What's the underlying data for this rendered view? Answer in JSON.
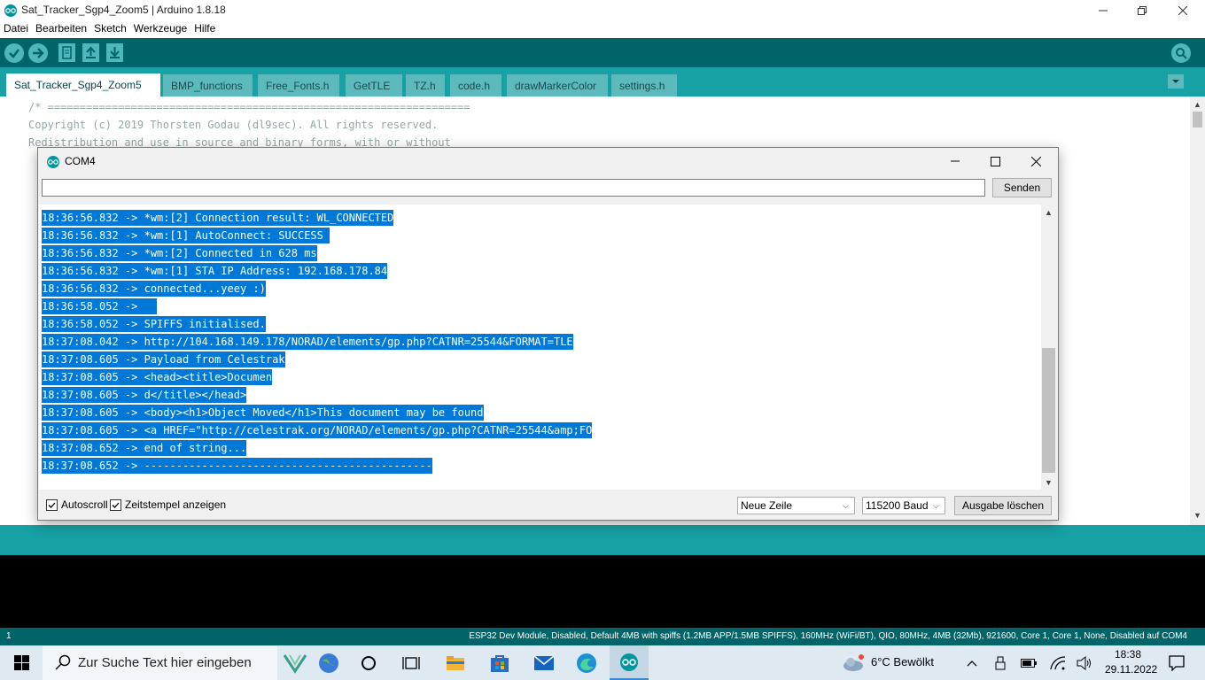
{
  "window": {
    "title": "Sat_Tracker_Sgp4_Zoom5 | Arduino 1.8.18"
  },
  "menu": [
    "Datei",
    "Bearbeiten",
    "Sketch",
    "Werkzeuge",
    "Hilfe"
  ],
  "toolbar": {
    "buttons": [
      "verify-icon",
      "upload-icon",
      "new-icon",
      "open-icon",
      "save-icon"
    ],
    "serial_monitor_icon": "magnifier-icon"
  },
  "tabs": [
    "Sat_Tracker_Sgp4_Zoom5",
    "BMP_functions",
    "Free_Fonts.h",
    "GetTLE",
    "TZ.h",
    "code.h",
    "drawMarkerColor",
    "settings.h"
  ],
  "editor": {
    "lines": [
      "/* ==================================================================",
      "Copyright (c) 2019 Thorsten Godau (dl9sec). All rights reserved.",
      "Redistribution and use in source and binary forms, with or without"
    ]
  },
  "serial_monitor": {
    "title": "COM4",
    "input_value": "",
    "send_label": "Senden",
    "lines": [
      "18:36:56.832 -> *wm:[2] Connection result: WL_CONNECTED",
      "18:36:56.832 -> *wm:[1] AutoConnect: SUCCESS ",
      "18:36:56.832 -> *wm:[2] Connected in 628 ms",
      "18:36:56.832 -> *wm:[1] STA IP Address: 192.168.178.84",
      "18:36:56.832 -> connected...yeey :)",
      "18:36:58.052 ->   ",
      "18:36:58.052 -> SPIFFS initialised.",
      "18:37:08.042 -> http://104.168.149.178/NORAD/elements/gp.php?CATNR=25544&FORMAT=TLE",
      "18:37:08.605 -> Payload from Celestrak",
      "18:37:08.605 -> <head><title>Documen",
      "18:37:08.605 -> d</title></head>",
      "18:37:08.605 -> <body><h1>Object Moved</h1>This document may be found",
      "18:37:08.605 -> <a HREF=\"http://celestrak.org/NORAD/elements/gp.php?CATNR=25544&amp;FO",
      "18:37:08.652 -> end of string...",
      "18:37:08.652 -> ---------------------------------------------"
    ],
    "autoscroll_label": "Autoscroll",
    "autoscroll_checked": true,
    "timestamp_label": "Zeitstempel anzeigen",
    "timestamp_checked": true,
    "line_ending": "Neue Zeile",
    "baud": "115200 Baud",
    "clear_label": "Ausgabe löschen"
  },
  "status": {
    "line_number": "1",
    "board": "ESP32 Dev Module, Disabled, Default 4MB with spiffs (1.2MB APP/1.5MB SPIFFS), 160MHz (WiFi/BT), QIO, 80MHz, 4MB (32Mb), 921600, Core 1, Core 1, None, Disabled auf COM4"
  },
  "taskbar": {
    "search_placeholder": "Zur Suche Text hier eingeben",
    "weather": "6°C  Bewölkt",
    "time": "18:38",
    "date": "29.11.2022"
  },
  "colors": {
    "teal_dark": "#006468",
    "teal": "#17a1a5",
    "selection": "#0078d7"
  }
}
